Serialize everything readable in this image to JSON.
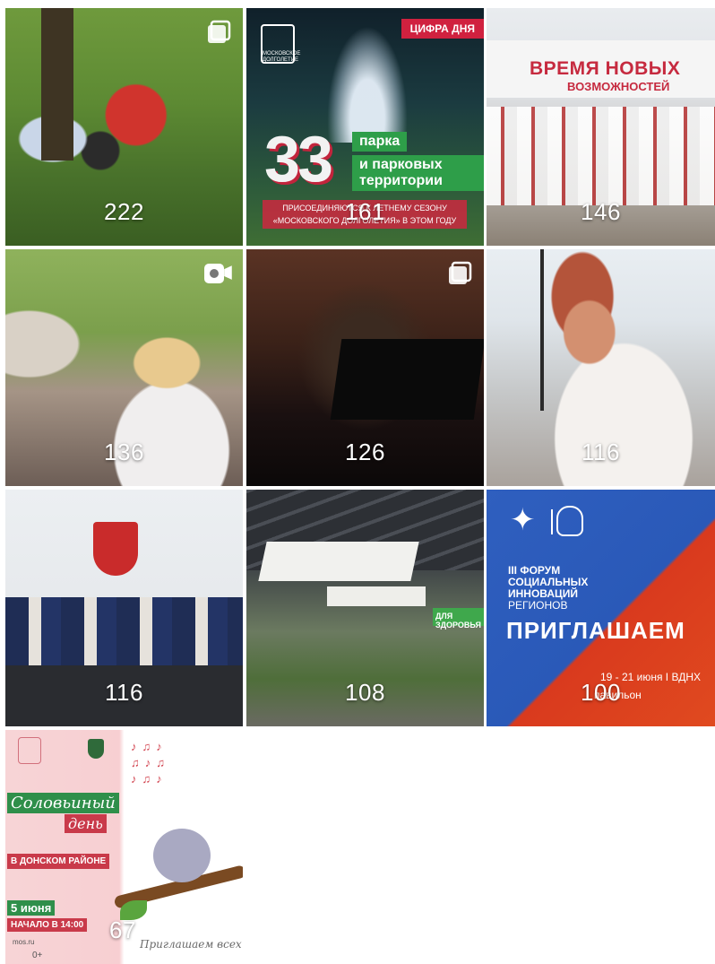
{
  "grid": {
    "tiles": [
      {
        "id": "t1",
        "count": "222",
        "badge": "carousel-icon"
      },
      {
        "id": "t2",
        "count": "161",
        "tag": "ЦИФРА ДНЯ",
        "logo_text": "МОСКОВСКОЕ ДОЛГОЛЕТИЕ",
        "big_number": "33",
        "line1": "парка",
        "line2": "и парковых территории",
        "sub": "ПРИСОЕДИНЯЮТСЯ К ЛЕТНЕМУ СЕЗОНУ «МОСКОВСКОГО ДОЛГОЛЕТИЯ» В ЭТОМ ГОДУ"
      },
      {
        "id": "t3",
        "count": "146",
        "banner_line1": "ВРЕМЯ НОВЫХ",
        "banner_line2": "ВОЗМОЖНОСТЕЙ"
      },
      {
        "id": "t4",
        "count": "136",
        "badge": "video-icon"
      },
      {
        "id": "t5",
        "count": "126",
        "badge": "carousel-icon"
      },
      {
        "id": "t6",
        "count": "116"
      },
      {
        "id": "t7",
        "count": "116"
      },
      {
        "id": "t8",
        "count": "108",
        "sign": "ДЛЯ ЗДОРОВЬЯ"
      },
      {
        "id": "t9",
        "count": "100",
        "forum_line1": "III ФОРУМ",
        "forum_line2": "СОЦИАЛЬНЫХ",
        "forum_line3": "ИННОВАЦИЙ",
        "forum_line4": "РЕГИОНОВ",
        "cta": "ПРИГЛАШАЕМ",
        "dates": "19 - 21 июня  I  ВДНХ",
        "place": "павильон"
      },
      {
        "id": "t10",
        "count": "67",
        "title1": "Соловьиный",
        "title2": "день",
        "district": "В ДОНСКОМ РАЙОНЕ",
        "date": "5 июня",
        "time": "НАЧАЛО В 14:00",
        "signature": "Приглашаем всех",
        "footer": "mos.ru",
        "age": "0+"
      }
    ]
  },
  "colors": {
    "accent_red": "#d0213f",
    "accent_green": "#2e9e49",
    "forum_blue": "#2f5fbf",
    "forum_orange": "#e04a1f",
    "count_text": "#ffffff"
  }
}
